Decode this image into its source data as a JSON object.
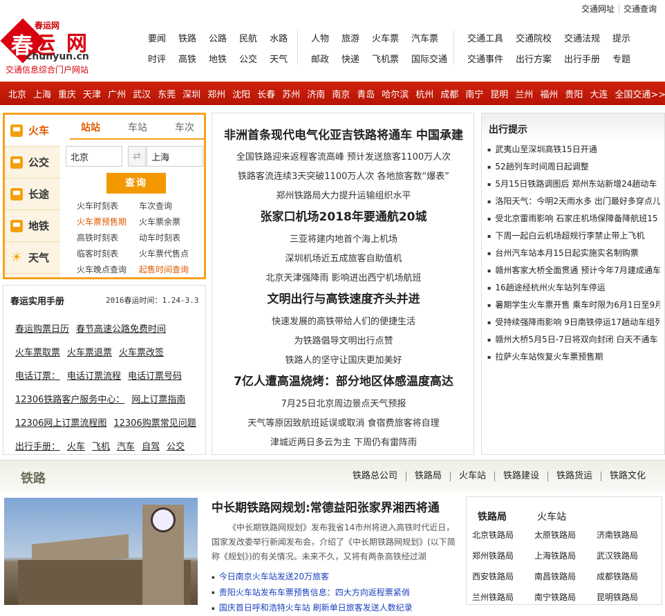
{
  "top_links": [
    "交通网址",
    "交通查询"
  ],
  "logo": {
    "cn_small": "春运网",
    "main_a": "春",
    "main_b": "运",
    "main_c": "网",
    "domain": "chunyun.cn",
    "slogan": "交通信息综合门户网站"
  },
  "nav": {
    "group1": {
      "row1": [
        "要闻",
        "铁路",
        "公路",
        "民航",
        "水路"
      ],
      "row2": [
        "时评",
        "高铁",
        "地铁",
        "公交",
        "天气"
      ]
    },
    "group2": {
      "row1": [
        "人物",
        "旅游",
        "火车票",
        "汽车票"
      ],
      "row2": [
        "邮政",
        "快递",
        "飞机票",
        "国际交通"
      ]
    },
    "group3": {
      "row1": [
        "交通工具",
        "交通院校",
        "交通法规",
        "提示"
      ],
      "row2": [
        "交通事件",
        "出行方案",
        "出行手册",
        "专题"
      ]
    }
  },
  "cities": [
    "北京",
    "上海",
    "重庆",
    "天津",
    "广州",
    "武汉",
    "东莞",
    "深圳",
    "郑州",
    "沈阳",
    "长春",
    "苏州",
    "济南",
    "南京",
    "青岛",
    "哈尔滨",
    "杭州",
    "成都",
    "南宁",
    "昆明",
    "兰州",
    "福州",
    "贵阳",
    "大连",
    "全国交通>>"
  ],
  "search": {
    "side_tabs": [
      {
        "label": "火车",
        "icon": "train-icon"
      },
      {
        "label": "公交",
        "icon": "bus-icon"
      },
      {
        "label": "长途",
        "icon": "coach-icon"
      },
      {
        "label": "地铁",
        "icon": "subway-icon"
      },
      {
        "label": "天气",
        "icon": "sun-icon"
      }
    ],
    "mode_tabs": [
      "站站",
      "车站",
      "车次"
    ],
    "from_value": "北京",
    "to_value": "上海",
    "swap_symbol": "⇄",
    "query_label": "查询",
    "links": [
      {
        "text": "火车时刻表",
        "hl": false
      },
      {
        "text": "车次查询",
        "hl": false
      },
      {
        "text": "火车票预售期",
        "hl": true
      },
      {
        "text": "火车票余票",
        "hl": false
      },
      {
        "text": "高铁时刻表",
        "hl": false
      },
      {
        "text": "动车时刻表",
        "hl": false
      },
      {
        "text": "临客时刻表",
        "hl": false
      },
      {
        "text": "火车票代售点",
        "hl": false
      },
      {
        "text": "火车晚点查询",
        "hl": false
      },
      {
        "text": "起售时间查询",
        "hl": true
      }
    ]
  },
  "handbook": {
    "title": "春运实用手册",
    "dates": "2016春运时间：1.24-3.3",
    "lines": [
      [
        "春运购票日历",
        "春节高速公路免费时间"
      ],
      [
        "火车票取票",
        "火车票退票",
        "火车票改签"
      ],
      [
        "电话订票：",
        "电话订票流程",
        "电话订票号码"
      ],
      [
        "12306铁路客户服务中心：",
        "网上订票指南"
      ],
      [
        "12306网上订票流程图",
        "12306购票常见问题"
      ],
      [
        "出行手册：",
        "火车",
        "飞机",
        "汽车",
        "自驾",
        "公交"
      ]
    ]
  },
  "headlines": [
    {
      "text": "非洲首条现代电气化亚吉铁路将通车 中国承建",
      "big": true
    },
    {
      "text": "全国铁路迎来返程客流高峰 预计发送旅客1100万人次",
      "big": false
    },
    {
      "text": "铁路客流连续3天突破1100万人次 各地旅客数“爆表”",
      "big": false
    },
    {
      "text": "郑州铁路局大力提升运输组织水平",
      "big": false
    },
    {
      "text": "张家口机场2018年要通航20城",
      "big": true
    },
    {
      "text": "三亚将建内地首个海上机场",
      "big": false
    },
    {
      "text": "深圳机场近五成旅客自助值机",
      "big": false
    },
    {
      "text": "北京天津强降雨 影响进出西宁机场航班",
      "big": false
    },
    {
      "text": "文明出行与高铁速度齐头并进",
      "big": true
    },
    {
      "text": "快速发展的高铁带给人们的便捷生活",
      "big": false
    },
    {
      "text": "为铁路倡导文明出行点赞",
      "big": false
    },
    {
      "text": "铁路人的坚守让国庆更加美好",
      "big": false
    },
    {
      "text": "7亿人遭高温烧烤：部分地区体感温度高达",
      "big": true
    },
    {
      "text": "7月25日北京周边景点天气预报",
      "big": false
    },
    {
      "text": "天气等原因致航班延误或取消 食宿费旅客将自理",
      "big": false
    },
    {
      "text": "津城近两日多云为主 下周仍有雷阵雨",
      "big": false
    }
  ],
  "tips": {
    "title": "出行提示",
    "items": [
      "武夷山至深圳高铁15日开通",
      "52趟列车时间周日起调整",
      "5月15日铁路调图后 郑州东站新增24趟动车",
      "洛阳天气：今明2天雨水多 出门最好多穿点儿",
      "受北京雷雨影响 石家庄机场保障备降航班15",
      "下周一起白云机场超规行李禁止带上飞机",
      "台州汽车站本月15日起实施实名制购票",
      "赣州客家大桥全面贯通 预计今年7月建成通车",
      "16趟途经杭州火车站列车停运",
      "暑期学生火车票开售 乘车时限为6月1日至9月",
      "受持续强降雨影响 9日南铁停运17趟动车组列",
      "赣州大桥5月5日-7日将双向封闭 白天不通车",
      "拉萨火车站恢复火车票预售期"
    ]
  },
  "rail": {
    "title": "铁路",
    "links": [
      "铁路总公司",
      "铁路局",
      "火车站",
      "铁路建设",
      "铁路货运",
      "铁路文化"
    ],
    "article": {
      "title": "中长期铁路网规划:常德益阳张家界湘西将通",
      "desc": "《中长期铁路网规划》发布我省14市州将进入高铁时代近日，国家发改委举行新闻发布会，介绍了《中长期铁路网规划》(以下简称《规划》)的有关情况。未来不久，又将有两条高铁经过湖",
      "links": [
        "今日南京火车站发送20万旅客",
        "贵阳火车站发布车票预售信息：四大方向返程票紧俏",
        "国庆首日呼和浩特火车站 刷新单日旅客发送人数纪录"
      ]
    },
    "bureau": {
      "tabs": [
        "铁路局",
        "火车站"
      ],
      "items": [
        "北京铁路局",
        "太原铁路局",
        "济南铁路局",
        "郑州铁路局",
        "上海铁路局",
        "武汉铁路局",
        "西安铁路局",
        "南昌铁路局",
        "成都铁路局",
        "兰州铁路局",
        "南宁铁路局",
        "昆明铁路局"
      ]
    }
  },
  "colors": {
    "accent": "#d8000f",
    "orange": "#f39800",
    "link_blue": "#1a3fbf"
  }
}
